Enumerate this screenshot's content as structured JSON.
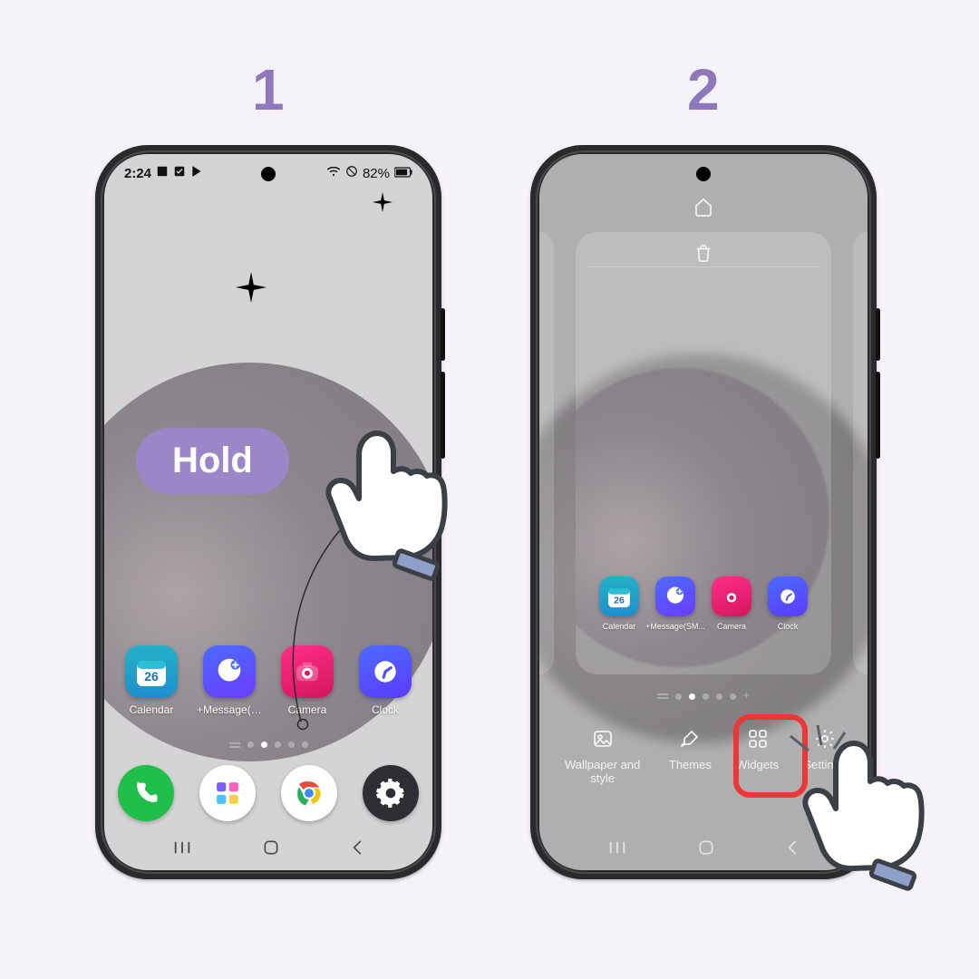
{
  "steps": {
    "one": "1",
    "two": "2"
  },
  "status": {
    "time": "2:24",
    "battery": "82%"
  },
  "annotation": {
    "hold": "Hold"
  },
  "home": {
    "apps": [
      {
        "name": "Calendar",
        "day": "26"
      },
      {
        "name": "+Message(SM..."
      },
      {
        "name": "Camera"
      },
      {
        "name": "Clock"
      }
    ]
  },
  "panel2": {
    "mini_apps": [
      {
        "name": "Calendar",
        "day": "26"
      },
      {
        "name": "+Message(SM..."
      },
      {
        "name": "Camera"
      },
      {
        "name": "Clock"
      }
    ]
  },
  "edit_bar": {
    "wallpaper": "Wallpaper and style",
    "themes": "Themes",
    "widgets": "Widgets",
    "settings": "Settings"
  }
}
